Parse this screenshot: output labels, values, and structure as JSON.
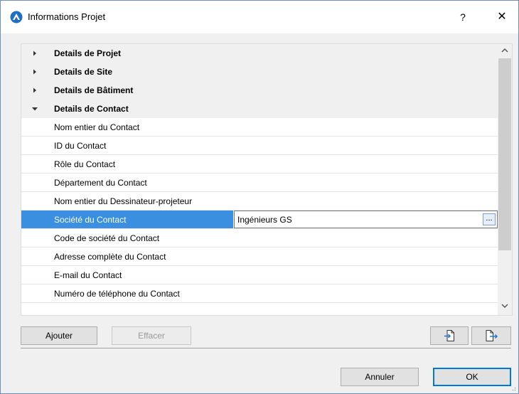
{
  "window": {
    "title": "Informations Projet",
    "help_label": "?",
    "close_label": "✕"
  },
  "groups": [
    {
      "label": "Details de Projet",
      "expanded": false
    },
    {
      "label": "Details de Site",
      "expanded": false
    },
    {
      "label": "Details de Bâtiment",
      "expanded": false
    },
    {
      "label": "Details de Contact",
      "expanded": true
    }
  ],
  "items": [
    {
      "label": "Nom entier du Contact"
    },
    {
      "label": "ID du Contact"
    },
    {
      "label": "Rôle du Contact"
    },
    {
      "label": "Département du Contact"
    },
    {
      "label": "Nom entier du Dessinateur-projeteur"
    },
    {
      "label": "Société du Contact",
      "value": "Ingénieurs GS",
      "selected": true
    },
    {
      "label": "Code de société du Contact"
    },
    {
      "label": "Adresse complète du Contact"
    },
    {
      "label": "E-mail du Contact"
    },
    {
      "label": "Numéro de téléphone du Contact"
    }
  ],
  "browse_label": "...",
  "buttons": {
    "add_label": "Ajouter",
    "delete_label": "Effacer",
    "import_icon": "import-file-icon",
    "export_icon": "export-file-icon",
    "cancel_label": "Annuler",
    "ok_label": "OK"
  },
  "colors": {
    "selection": "#3a8fe0",
    "default_button_border": "#0078d7"
  }
}
